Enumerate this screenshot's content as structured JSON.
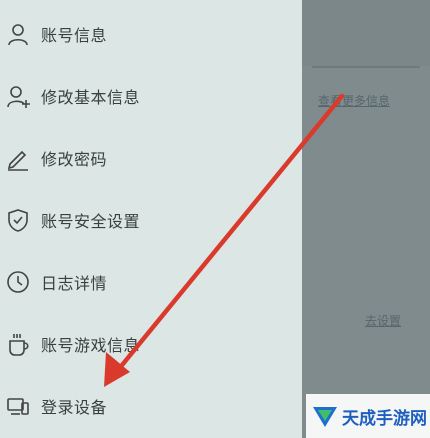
{
  "drawer": {
    "items": [
      {
        "label": "账号信息",
        "icon": "user-icon"
      },
      {
        "label": "修改基本信息",
        "icon": "user-add-icon"
      },
      {
        "label": "修改密码",
        "icon": "pencil-icon"
      },
      {
        "label": "账号安全设置",
        "icon": "shield-check-icon"
      },
      {
        "label": "日志详情",
        "icon": "clock-icon"
      },
      {
        "label": "账号游戏信息",
        "icon": "cup-icon"
      },
      {
        "label": "登录设备",
        "icon": "devices-icon"
      }
    ]
  },
  "background": {
    "more_info_link": "查看更多信息",
    "go_settings_link": "去设置"
  },
  "watermark": {
    "text": "天成手游网"
  },
  "colors": {
    "drawer_bg": "#dbe6e5",
    "overlay_bg": "#7f8b8c",
    "arrow": "#d93a2b",
    "text": "#3a4040"
  }
}
